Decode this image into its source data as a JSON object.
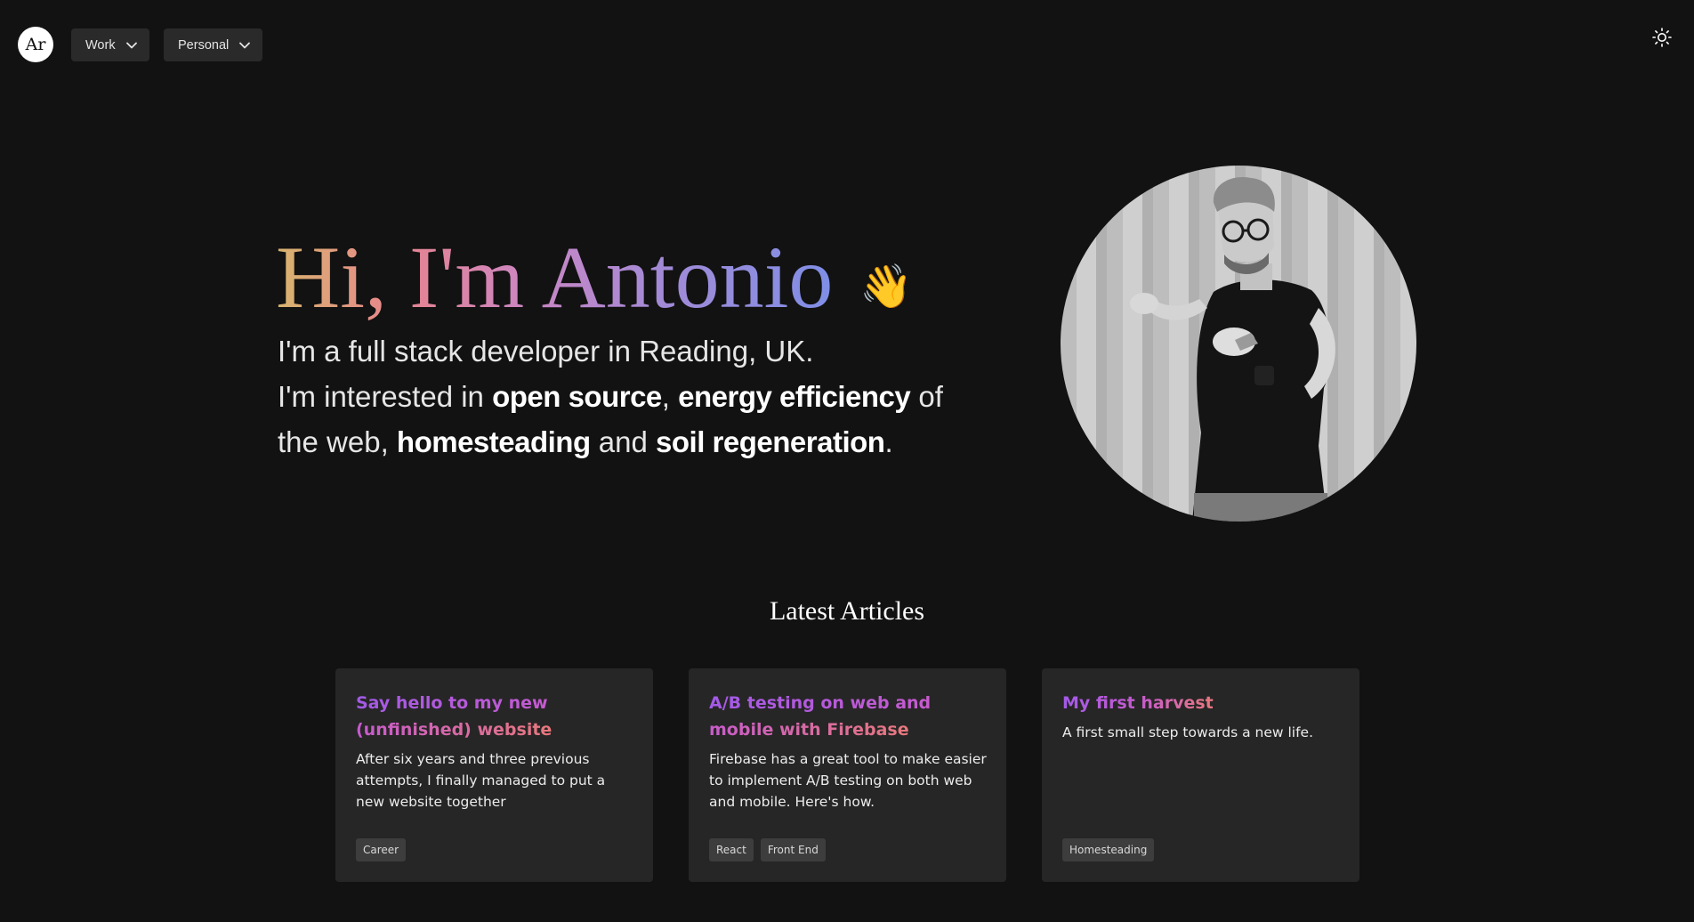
{
  "header": {
    "logo_text": "Ar",
    "menus": [
      {
        "label": "Work"
      },
      {
        "label": "Personal"
      }
    ],
    "theme_icon": "sun-icon"
  },
  "hero": {
    "greeting": "Hi, I'm Antonio",
    "wave_emoji": "👋",
    "line1": "I'm a full stack developer in Reading, UK.",
    "line2_prefix": "I'm interested in ",
    "highlight1": "open source",
    "sep1": ", ",
    "highlight2": "energy efficiency",
    "line2_mid": " of the web, ",
    "highlight3": "homesteading",
    "sep2": " and ",
    "highlight4": "soil regeneration",
    "end": "."
  },
  "articles": {
    "heading": "Latest Articles",
    "items": [
      {
        "title": "Say hello to my new (unfinished) website",
        "description": "After six years and three previous attempts, I finally managed to put a new website together",
        "tags": [
          "Career"
        ]
      },
      {
        "title": "A/B testing on web and mobile with Firebase",
        "description": "Firebase has a great tool to make easier to implement A/B testing on both web and mobile. Here's how.",
        "tags": [
          "React",
          "Front End"
        ]
      },
      {
        "title": "My first harvest",
        "description": "A first small step towards a new life.",
        "tags": [
          "Homesteading"
        ]
      }
    ]
  },
  "colors": {
    "background": "#121212",
    "card": "#262626",
    "accent_purple": "#a35ae8",
    "accent_pink": "#e8787c"
  }
}
